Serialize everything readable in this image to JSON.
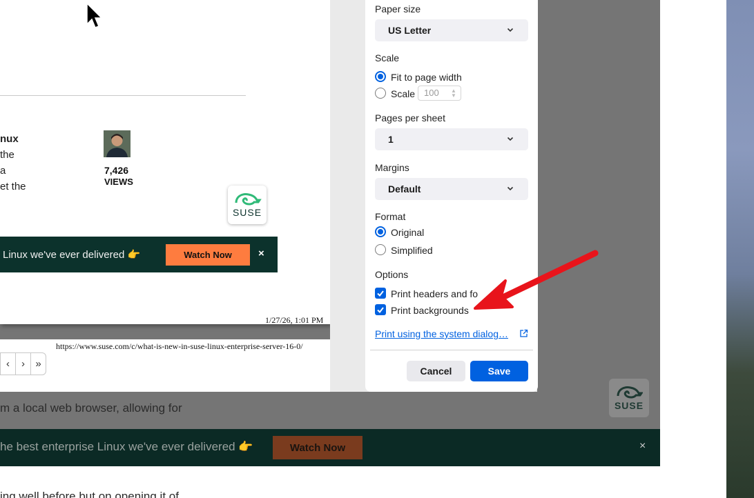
{
  "background_page": {
    "text_line_1": "m a local web browser, allowing for",
    "text_line_2": "ing well before but on opening it of",
    "banner_text": "he best enterprise Linux we've ever delivered 👉",
    "banner_button": "Watch Now",
    "banner_close": "×",
    "suse_label": "SUSE"
  },
  "preview": {
    "snippets": [
      "nux",
      "the",
      "a",
      "et the"
    ],
    "views_count": "7,426",
    "views_label": "VIEWS",
    "suse_label": "SUSE",
    "banner_text": "Linux we've ever delivered 👉",
    "banner_button": "Watch Now",
    "banner_close": "×",
    "date_footer": "1/27/26, 1:01 PM",
    "url_header": "https://www.suse.com/c/what-is-new-in-suse-linux-enterprise-server-16-0/",
    "pager": [
      "‹",
      "›",
      "»"
    ]
  },
  "print_settings": {
    "paper_size": {
      "label": "Paper size",
      "value": "US Letter"
    },
    "scale": {
      "label": "Scale",
      "options": [
        "Fit to page width",
        "Scale"
      ],
      "selected": "Fit to page width",
      "scale_value": "100"
    },
    "pages_per_sheet": {
      "label": "Pages per sheet",
      "value": "1"
    },
    "margins": {
      "label": "Margins",
      "value": "Default"
    },
    "format": {
      "label": "Format",
      "options": [
        "Original",
        "Simplified"
      ],
      "selected": "Original"
    },
    "options": {
      "label": "Options",
      "items": [
        {
          "label": "Print headers and fo",
          "checked": true
        },
        {
          "label": "Print backgrounds",
          "checked": true
        }
      ]
    },
    "system_dialog_link": "Print using the system dialog…",
    "cancel_label": "Cancel",
    "save_label": "Save"
  },
  "colors": {
    "accent": "#0061e0",
    "banner_dark": "#0c322c",
    "watch_orange": "#fe7c3f",
    "annotation_red": "#e8141b"
  },
  "icons": [
    "mouse-cursor-icon",
    "chevron-down-icon",
    "external-link-icon",
    "checkmark-icon",
    "suse-chameleon-logo",
    "red-annotation-arrow"
  ]
}
